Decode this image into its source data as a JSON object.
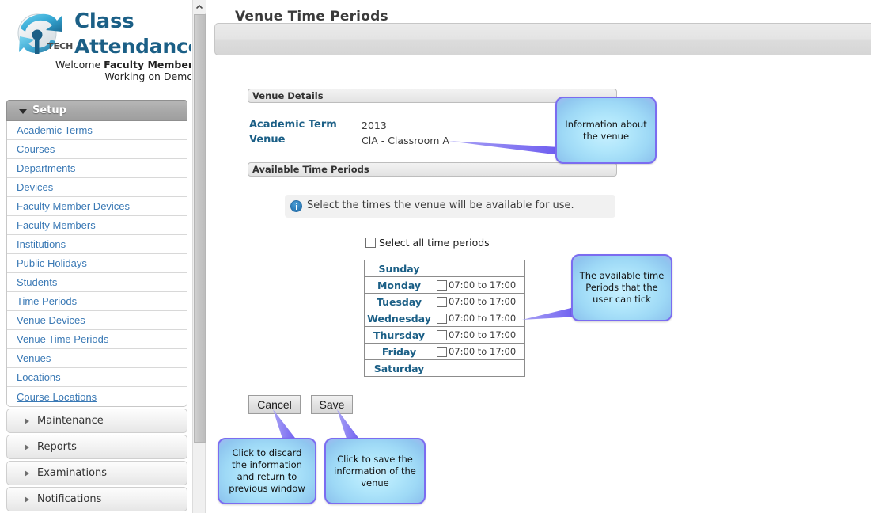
{
  "brand": {
    "logo_icon": "iptech-globe-logo",
    "logo_text": "TECH",
    "title_line1": "Class",
    "title_line2": "Attendance",
    "welcome_prefix": "Welcome ",
    "welcome_user": "Faculty Member",
    "working_on": "Working on Demo"
  },
  "sidebar": {
    "setup": {
      "label": "Setup",
      "expanded": true,
      "items": [
        {
          "label": "Academic Terms"
        },
        {
          "label": "Courses"
        },
        {
          "label": "Departments"
        },
        {
          "label": "Devices"
        },
        {
          "label": "Faculty Member Devices"
        },
        {
          "label": "Faculty Members"
        },
        {
          "label": "Institutions"
        },
        {
          "label": "Public Holidays"
        },
        {
          "label": "Students"
        },
        {
          "label": "Time Periods"
        },
        {
          "label": "Venue Devices"
        },
        {
          "label": "Venue Time Periods"
        },
        {
          "label": "Venues"
        },
        {
          "label": "Locations"
        },
        {
          "label": "Course Locations"
        }
      ]
    },
    "collapsed_sections": [
      {
        "label": "Maintenance"
      },
      {
        "label": "Reports"
      },
      {
        "label": "Examinations"
      },
      {
        "label": "Notifications"
      }
    ]
  },
  "page": {
    "title": "Venue Time Periods"
  },
  "venue_details": {
    "section_title": "Venue Details",
    "rows": [
      {
        "label": "Academic Term",
        "value": "2013"
      },
      {
        "label": "Venue",
        "value": "ClA - Classroom A"
      }
    ]
  },
  "available_time_periods": {
    "section_title": "Available Time Periods",
    "info_icon": "info-circle-icon",
    "info_message": "Select the times the venue will be available for use.",
    "select_all_label": "Select all time periods",
    "select_all_checked": false,
    "rows": [
      {
        "day": "Sunday",
        "slot": "",
        "has_checkbox": false,
        "checked": false
      },
      {
        "day": "Monday",
        "slot": "07:00 to 17:00",
        "has_checkbox": true,
        "checked": false
      },
      {
        "day": "Tuesday",
        "slot": "07:00 to 17:00",
        "has_checkbox": true,
        "checked": false
      },
      {
        "day": "Wednesday",
        "slot": "07:00 to 17:00",
        "has_checkbox": true,
        "checked": false
      },
      {
        "day": "Thursday",
        "slot": "07:00 to 17:00",
        "has_checkbox": true,
        "checked": false
      },
      {
        "day": "Friday",
        "slot": "07:00 to 17:00",
        "has_checkbox": true,
        "checked": false
      },
      {
        "day": "Saturday",
        "slot": "",
        "has_checkbox": false,
        "checked": false
      }
    ]
  },
  "actions": {
    "cancel_label": "Cancel",
    "save_label": "Save"
  },
  "callouts": {
    "venue_info": "Information about the venue",
    "time_periods": "The available time Periods that the user can tick",
    "cancel": "Click to discard the information and return to previous window",
    "save": "Click to save the information of the venue"
  },
  "scrollbar": {
    "up_arrow_icon": "chevron-up-icon"
  },
  "colors": {
    "brand_blue": "#1b5f86",
    "link_blue": "#3a79b5",
    "callout_border": "#7b6cf0",
    "callout_fill": "#9ed9f6",
    "accordion_header": "#a9a9a9"
  }
}
